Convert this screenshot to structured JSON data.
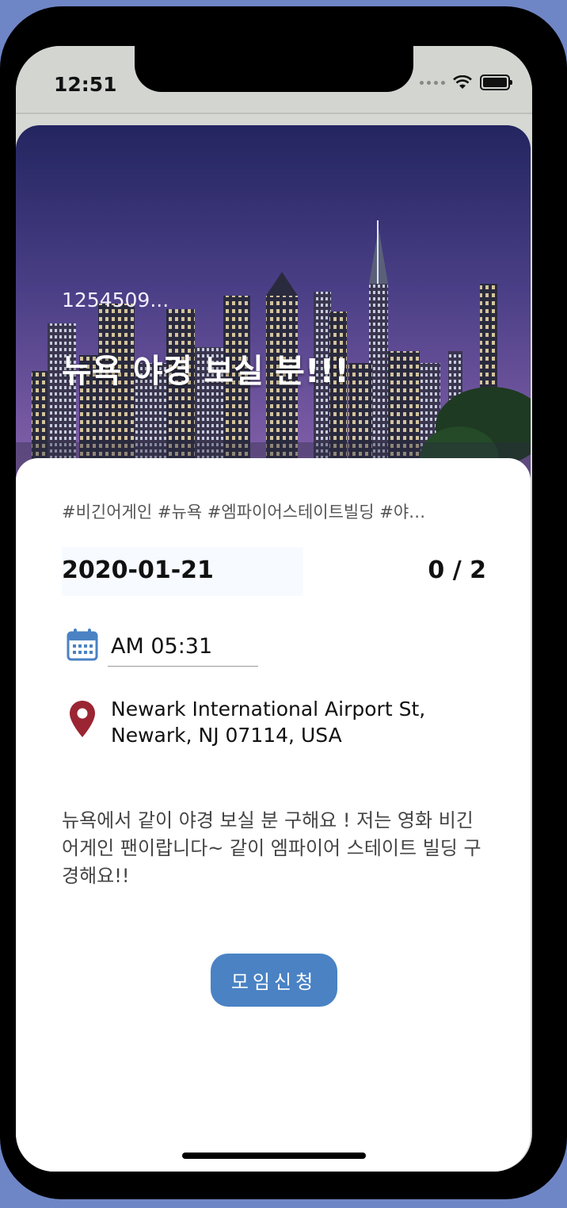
{
  "status_bar": {
    "time": "12:51",
    "icons": [
      "signal-dots-icon",
      "wifi-icon",
      "battery-icon"
    ]
  },
  "meeting": {
    "id": "1254509...",
    "title": "뉴욕 야경 보실 분!!!",
    "tags": "#비긴어게인 #뉴욕 #엠파이어스테이트빌딩 #야…",
    "date": "2020-01-21",
    "participants": "0 / 2",
    "time": "AM 05:31",
    "address": "Newark International Airport St, Newark, NJ 07114, USA",
    "description": "뉴욕에서 같이 야경 보실 분 구해요 ! 저는 영화 비긴어게인 팬이랍니다~ 같이 엠파이어 스테이트 빌딩 구경해요!!",
    "join_label": "모임신청"
  },
  "colors": {
    "accent": "#4a82c4",
    "pin": "#9b2533",
    "calendar": "#4a82c4",
    "hero_sky_top": "#2b2d6b",
    "hero_sky_bottom": "#7b5aa6"
  }
}
